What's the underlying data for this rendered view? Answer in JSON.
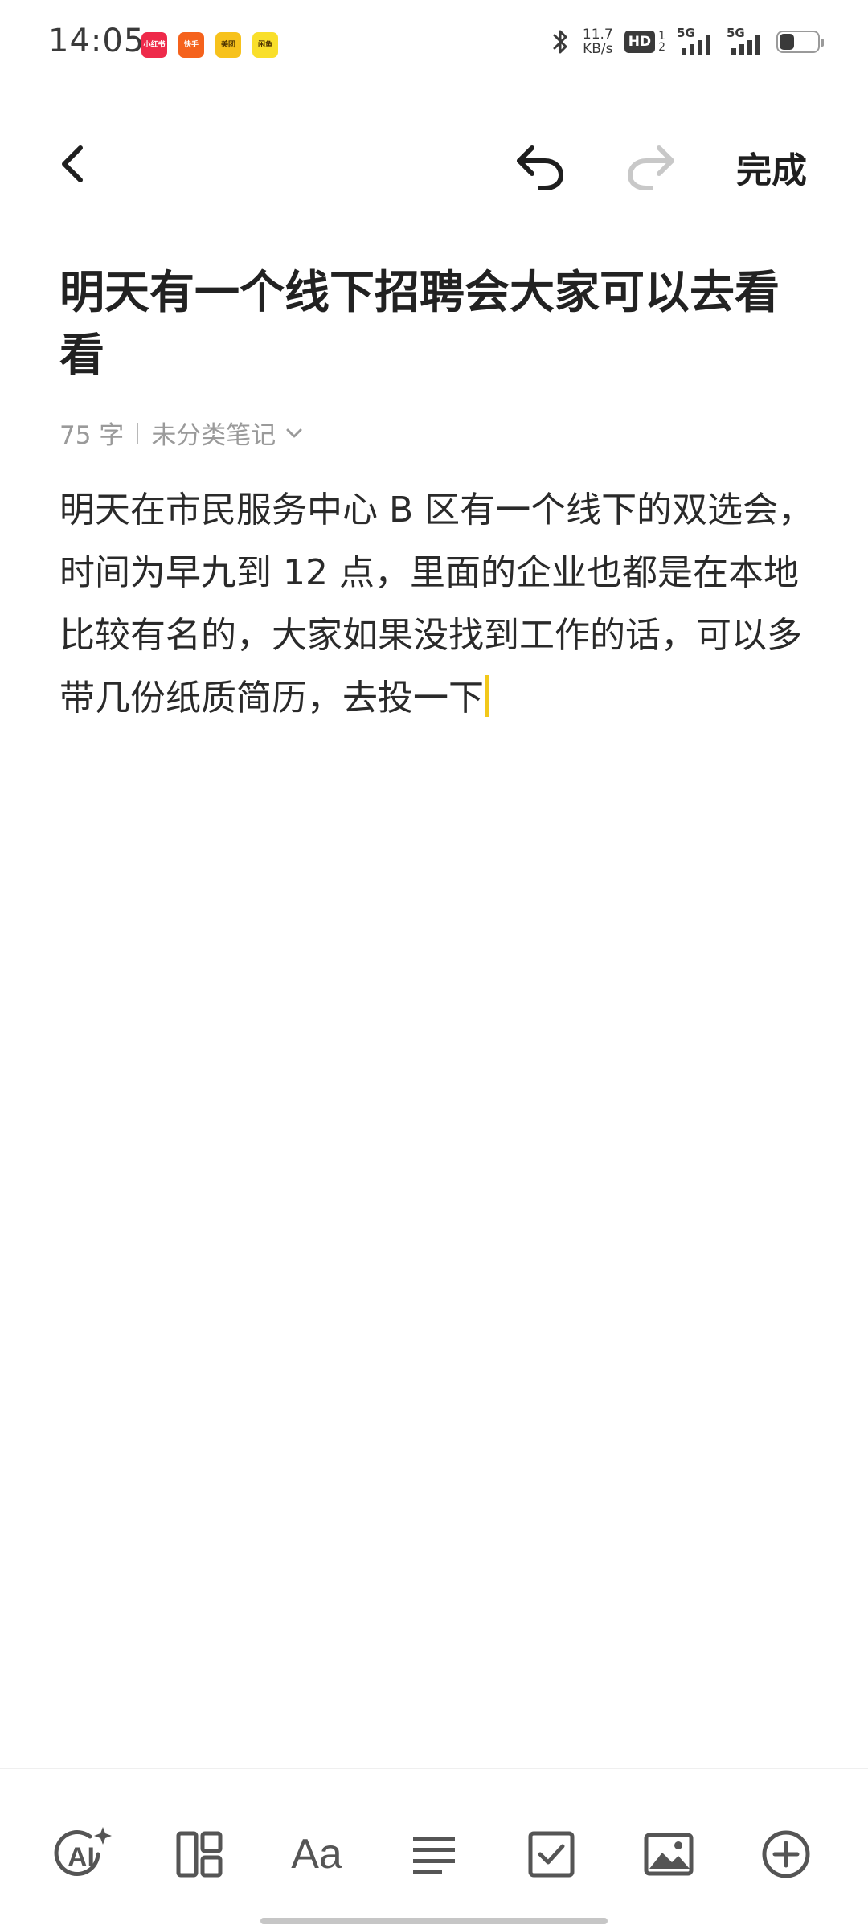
{
  "status_bar": {
    "time": "14:05",
    "notification_apps": [
      "小红书",
      "快手",
      "美团",
      "闲鱼"
    ],
    "net_speed_value": "11.7",
    "net_speed_unit": "KB/s",
    "hd_label": "HD",
    "hd_sub_top": "1",
    "hd_sub_bottom": "2",
    "signal1_label": "5G",
    "signal2_label": "5G",
    "battery_level": 0.4
  },
  "toolbar": {
    "done_label": "完成"
  },
  "note": {
    "title": "明天有一个线下招聘会大家可以去看看",
    "word_count": "75 字",
    "category": "未分类笔记",
    "body": "明天在市民服务中心 B 区有一个线下的双选会，时间为早九到 12 点，里面的企业也都是在本地比较有名的，大家如果没找到工作的话，可以多带几份纸质简历，去投一下"
  },
  "bottom_toolbar": {
    "ai_label": "AI",
    "font_label": "Aa",
    "icons": [
      "ai-icon",
      "layout-icon",
      "font-icon",
      "align-icon",
      "checkbox-icon",
      "image-icon",
      "add-icon"
    ]
  },
  "colors": {
    "cursor": "#f2c81a",
    "text": "#2a2a2a",
    "muted": "#9a9a9a",
    "redo_disabled": "#c8c8c8"
  }
}
